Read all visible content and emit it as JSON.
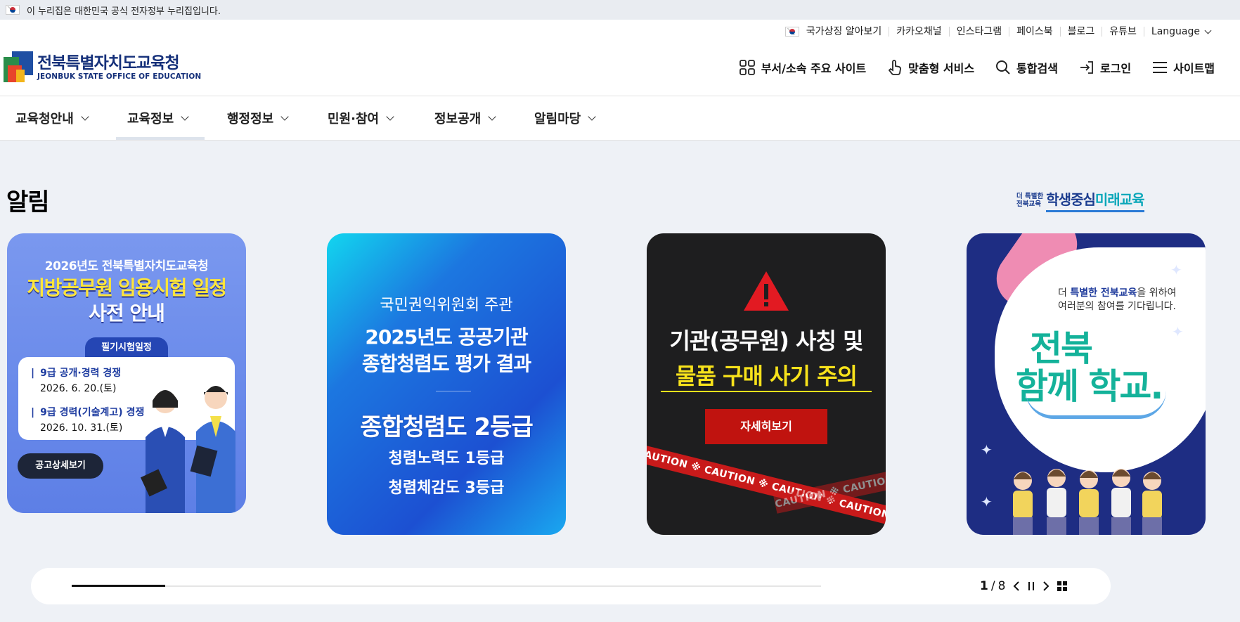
{
  "govbar": {
    "text": "이 누리집은 대한민국 공식 전자정부 누리집입니다."
  },
  "util_links": [
    "국가상징 알아보기",
    "카카오채널",
    "인스타그램",
    "페이스북",
    "블로그",
    "유튜브",
    "Language"
  ],
  "logo": {
    "ko": "전북특별자치도교육청",
    "en": "JEONBUK STATE OFFICE OF EDUCATION"
  },
  "quick_menu": [
    "부서/소속 주요 사이트",
    "맞춤형 서비스",
    "통합검색",
    "로그인",
    "사이트맵"
  ],
  "gnb": [
    "교육청안내",
    "교육정보",
    "행정정보",
    "민원·참여",
    "정보공개",
    "알림마당"
  ],
  "gnb_active_index": 1,
  "section_title": "알림",
  "slogan": {
    "small1": "더 특별한",
    "small2": "전북교육",
    "big_pre": "학생중심",
    "big_post": "미래교육"
  },
  "cards": [
    {
      "top": "2026년도 전북특별자치도교육청",
      "h1": "지방공무원 임용시험 일정",
      "h2": "사전 안내",
      "pill": "필기시험일정",
      "items": [
        {
          "title": "9급 공개·경력 경쟁",
          "date": "2026. 6. 20.(토)"
        },
        {
          "title": "9급 경력(기술계고) 경쟁",
          "date": "2026. 10. 31.(토)"
        }
      ],
      "button": "공고상세보기"
    },
    {
      "a": "국민권익위원회 주관",
      "b": "2025년도 공공기관",
      "c": "종합청렴도 평가 결과",
      "d": "종합청렴도 2등급",
      "e": "청렴노력도 1등급",
      "f": "청렴체감도 3등급"
    },
    {
      "a": "기관(공무원) 사칭 및",
      "b": "물품 구매 사기 주의",
      "button": "자세히보기",
      "tape": "CAUTION ※ CAUTION ※ CAUTION ※ CAUTION ※ CAUTION ※ CAUTION"
    },
    {
      "txt_pre": "더 ",
      "txt_hl": "특별한 전북교육",
      "txt_post": "을 위하여",
      "txt2": "여러분의 참여를 기다립니다.",
      "big1": "전북",
      "big2": "함께 학교."
    }
  ],
  "pager": {
    "current": "1",
    "total": "8",
    "progress": 0.125
  },
  "colors": {
    "brand": "#15307a",
    "accent_yellow": "#ffe53a",
    "caution_red": "#c0130f",
    "teal": "#14b29a"
  }
}
